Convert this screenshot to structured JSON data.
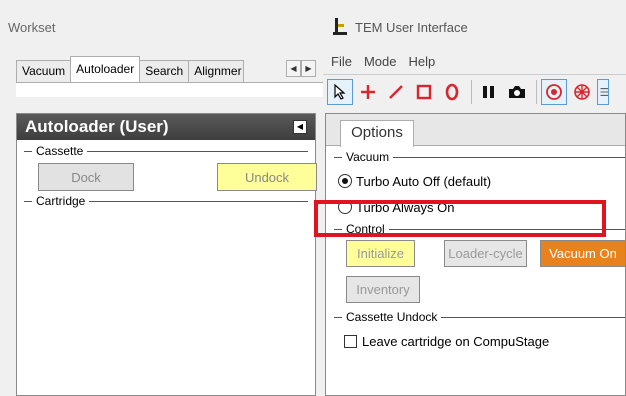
{
  "workset": {
    "title": "Workset",
    "tabs": [
      {
        "label": "Vacuum"
      },
      {
        "label": "Autoloader"
      },
      {
        "label": "Search"
      },
      {
        "label": "Alignmer"
      }
    ],
    "panel": {
      "title": "Autoloader (User)",
      "cassette_label": "Cassette",
      "dock_label": "Dock",
      "undock_label": "Undock",
      "cartridge_label": "Cartridge"
    }
  },
  "tem": {
    "window_title": "TEM User Interface",
    "menu": [
      "File",
      "Mode",
      "Help"
    ],
    "toolbar_icons": [
      "select-arrow-icon",
      "crosshair-icon",
      "line-icon",
      "square-icon",
      "circle-icon",
      "pause-icon",
      "camera-icon",
      "target-icon",
      "snowflake-icon",
      "grid-icon"
    ],
    "options_tab": "Options",
    "vacuum_label": "Vacuum",
    "turbo_auto_off": "Turbo Auto Off (default)",
    "turbo_always_on": "Turbo Always On",
    "control_label": "Control",
    "initialize_label": "Initialize",
    "loader_cycle_label": "Loader-cycle",
    "vacuum_on_label": "Vacuum On",
    "inventory_label": "Inventory",
    "cassette_undock_label": "Cassette Undock",
    "leave_cartridge_label": "Leave cartridge on CompuStage",
    "selected_turbo_mode": "Turbo Auto Off (default)",
    "leave_cartridge_checked": false
  },
  "colors": {
    "highlight": "#e0141e",
    "yellow_button": "#ffff99",
    "orange_button": "#e8821e",
    "panel_header": "#474747"
  }
}
